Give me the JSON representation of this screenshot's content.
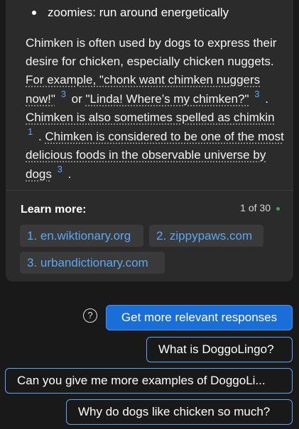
{
  "answer": {
    "bullet": "zoomies: run around energetically",
    "p1": "Chimken is often used by dogs to express their desire for chicken, especially chicken nuggets. ",
    "c1": "For example, \"chonk want chimken nuggers now!\"",
    "s1": "3",
    "p2": " or ",
    "c2": "\"Linda! Where’s my chimken?\"",
    "s2": "3",
    "p3": " . ",
    "c3": "Chimken is also sometimes spelled as chimkin",
    "s3": "1",
    "p4": " . ",
    "c4": "Chimken is considered to be one of the most delicious foods in the observable universe by dogs",
    "s4": "3",
    "p5": " ."
  },
  "learn_more": {
    "label": "Learn more:",
    "page_count": "1 of 30",
    "sources": [
      "1. en.wiktionary.org",
      "2. zippypaws.com",
      "3. urbandictionary.com"
    ]
  },
  "actions": {
    "help_glyph": "?",
    "primary": "Get more relevant responses"
  },
  "suggestions": [
    "What is DoggoLingo?",
    "Can you give me more examples of DoggoLi...",
    "Why do dogs like chicken so much?"
  ],
  "colors": {
    "background": "#191919",
    "card": "#2b2b2b",
    "link": "#5aa8f5",
    "primary": "#1a6ed8"
  },
  "icons": [
    "bullet-dot",
    "help-icon",
    "status-dot"
  ]
}
